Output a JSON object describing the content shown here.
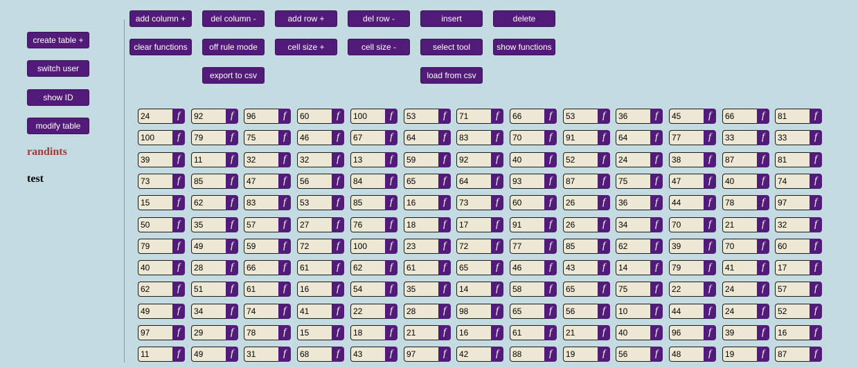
{
  "colors": {
    "background": "#c3dbe1",
    "button": "#521b7a",
    "button_text": "#ffffff",
    "cell_bg": "#ede8d3",
    "active_table": "#a33a3a",
    "inactive_table": "#000000"
  },
  "sidebar": {
    "create_table": "create table +",
    "switch_user": "switch user",
    "show_id": "show ID",
    "modify_table": "modify table",
    "tables": [
      "randints",
      "test"
    ]
  },
  "toolbar": {
    "row1": [
      "add column +",
      "del column -",
      "add row +",
      "del row -",
      "insert",
      "delete"
    ],
    "row2": [
      "clear functions",
      "off rule mode",
      "cell size +",
      "cell size -",
      "select tool",
      "show functions"
    ],
    "export_csv": "export to csv",
    "load_csv": "load from csv"
  },
  "function_button_label": "f",
  "table": [
    [
      "24",
      "92",
      "96",
      "60",
      "100",
      "53",
      "71",
      "66",
      "53",
      "36",
      "45",
      "66",
      "81"
    ],
    [
      "100",
      "79",
      "75",
      "46",
      "67",
      "64",
      "83",
      "70",
      "91",
      "64",
      "77",
      "33",
      "33"
    ],
    [
      "39",
      "11",
      "32",
      "32",
      "13",
      "59",
      "92",
      "40",
      "52",
      "24",
      "38",
      "87",
      "81"
    ],
    [
      "73",
      "85",
      "47",
      "56",
      "84",
      "65",
      "64",
      "93",
      "87",
      "75",
      "47",
      "40",
      "74"
    ],
    [
      "15",
      "62",
      "83",
      "53",
      "85",
      "16",
      "73",
      "60",
      "26",
      "36",
      "44",
      "78",
      "97"
    ],
    [
      "50",
      "35",
      "57",
      "27",
      "76",
      "18",
      "17",
      "91",
      "26",
      "34",
      "70",
      "21",
      "32"
    ],
    [
      "79",
      "49",
      "59",
      "72",
      "100",
      "23",
      "72",
      "77",
      "85",
      "62",
      "39",
      "70",
      "60"
    ],
    [
      "40",
      "28",
      "66",
      "61",
      "62",
      "61",
      "65",
      "46",
      "43",
      "14",
      "79",
      "41",
      "17"
    ],
    [
      "62",
      "51",
      "61",
      "16",
      "54",
      "35",
      "14",
      "58",
      "65",
      "75",
      "22",
      "24",
      "57"
    ],
    [
      "49",
      "34",
      "74",
      "41",
      "22",
      "28",
      "98",
      "65",
      "56",
      "10",
      "44",
      "24",
      "52"
    ],
    [
      "97",
      "29",
      "78",
      "15",
      "18",
      "21",
      "16",
      "61",
      "21",
      "40",
      "96",
      "39",
      "16"
    ],
    [
      "11",
      "49",
      "31",
      "68",
      "43",
      "97",
      "42",
      "88",
      "19",
      "56",
      "48",
      "19",
      "87"
    ]
  ]
}
